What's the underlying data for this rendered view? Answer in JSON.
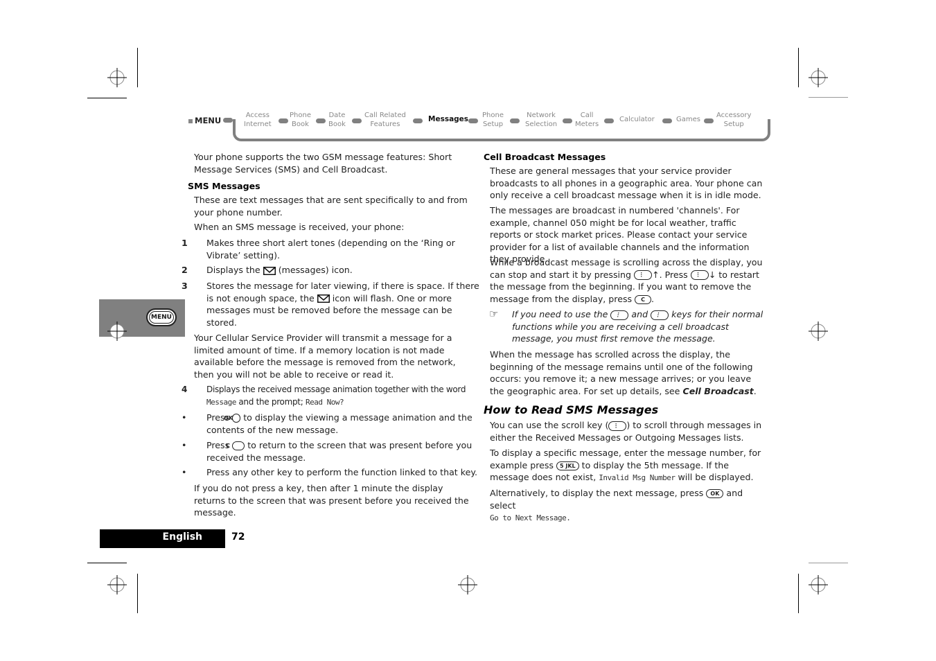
{
  "nav": {
    "menu_label": "MENU",
    "items": [
      {
        "l1": "Access",
        "l2": "Internet"
      },
      {
        "l1": "Phone",
        "l2": "Book"
      },
      {
        "l1": "Date",
        "l2": "Book"
      },
      {
        "l1": "Call Related",
        "l2": "Features"
      },
      {
        "l1": "Messages",
        "l2": "",
        "active": true
      },
      {
        "l1": "Phone",
        "l2": "Setup"
      },
      {
        "l1": "Network",
        "l2": "Selection"
      },
      {
        "l1": "Call",
        "l2": "Meters"
      },
      {
        "l1": "Calculator",
        "l2": ""
      },
      {
        "l1": "Games",
        "l2": ""
      },
      {
        "l1": "Accessory",
        "l2": "Setup"
      }
    ]
  },
  "side_tab": {
    "key_label": "MENU"
  },
  "left": {
    "intro": "Your phone supports the two GSM message features: Short Message Services (SMS) and Cell Broadcast.",
    "sms_heading": "SMS Messages",
    "sms_p1": "These are text messages that are sent specifically to and from your phone number.",
    "sms_p2": "When an SMS message is received, your phone:",
    "steps": [
      {
        "n": "1",
        "text": "Makes three short alert tones (depending on the ‘Ring or Vibrate’ setting)."
      },
      {
        "n": "2",
        "pre": "Displays the",
        "post": "(messages) icon."
      },
      {
        "n": "3",
        "pre": "Stores the message for later viewing, if there is space. If there is not enough space, the",
        "post": "icon will flash. One or more messages must be removed before the message can be stored."
      }
    ],
    "provider_p": "Your Cellular Service Provider will transmit a message for a limited amount of time. If a memory location is not made available before the message is removed from the network, then you will not be able to receive or read it.",
    "step4": {
      "n": "4",
      "pre": "Displays the received message animation together with the word",
      "word": "Message",
      "mid": "and the prompt;",
      "prompt": "Read Now?"
    },
    "bullets": [
      {
        "pre": "Press",
        "key": "OK",
        "post": "to display the viewing a message animation and the contents of the new message."
      },
      {
        "pre": "Press",
        "key": "C",
        "post": "to return to the screen that was present before you received the message."
      },
      {
        "pre": "Press any other key to perform the function linked to that key.",
        "key": "",
        "post": ""
      }
    ],
    "timeout_p": "If you do not press a key, then after 1 minute the display returns to the screen that was present before you received the message."
  },
  "right": {
    "cb_heading": "Cell Broadcast Messages",
    "cb_p1": "These are general messages that your service provider broadcasts to all phones in a geographic area. Your phone can only receive a cell broadcast message when it is in idle mode.",
    "cb_p2": "The messages are broadcast in numbered 'channels'. For example, channel 050 might be for local weather, traffic reports or stock market prices. Please contact your service provider for a list of available channels and the information they provide.",
    "cb_p3_a": "While a broadcast message is scrolling across the display, you can stop and start it by pressing",
    "cb_p3_b": "↑. Press",
    "cb_p3_c": "↓ to restart the message from the beginning. If you want to remove the message from the display, press",
    "cb_p3_key": "C",
    "note_a": "If you need to use the",
    "note_b": "and",
    "note_c": "keys for their normal functions while you are receiving a cell broadcast message, you must first remove the message.",
    "cb_p4": "When the message has scrolled across the display, the beginning of the message remains until one of the following occurs: you remove it; a new message arrives; or you leave the geographic area. For set up details, see",
    "cb_p4_link": "Cell Broadcast",
    "read_heading": "How to Read SMS Messages",
    "read_p1_a": "You can use the scroll key (",
    "read_p1_b": ") to scroll through messages in either the Received Messages or Outgoing Messages lists.",
    "read_p2_a": "To display a specific message, enter the message number, for example press",
    "read_p2_key": "5 JKL",
    "read_p2_b": "to display the 5th message. If the message does not exist,",
    "read_p2_display": "Invalid Msg Number",
    "read_p2_c": "will be displayed.",
    "read_p3_a": "Alternatively, to display the next message, press",
    "read_p3_key": "OK",
    "read_p3_b": "and select",
    "read_p3_display": "Go to Next Message."
  },
  "footer": {
    "language": "English",
    "page_number": "72"
  }
}
